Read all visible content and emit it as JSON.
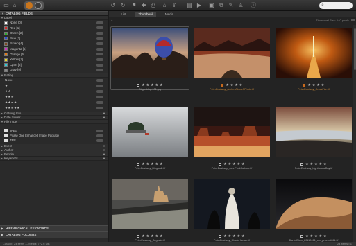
{
  "toolbar": {
    "icons": [
      "folder-icon",
      "home-icon",
      "rotate-left-icon",
      "rotate-right-icon",
      "flag-icon",
      "pick-icon",
      "print-icon",
      "shop-icon",
      "export-icon",
      "play-icon",
      "view-icon",
      "copy-icon",
      "paint-icon",
      "stamp-icon",
      "info-icon"
    ],
    "search_placeholder": ""
  },
  "sidebar": {
    "catalog_fields": "CATALOG FIELDS",
    "label_heading": "Label",
    "labels": [
      {
        "name": "None [0]",
        "color": "#ffffff"
      },
      {
        "name": "Red [1]",
        "color": "#d42b2b"
      },
      {
        "name": "Green [2]",
        "color": "#2fa82f"
      },
      {
        "name": "Blue [3]",
        "color": "#2a4fd6"
      },
      {
        "name": "Brown [4]",
        "color": "#7a4a24"
      },
      {
        "name": "Magenta [5]",
        "color": "#cc2fbe"
      },
      {
        "name": "Orange [6]",
        "color": "#e07a18"
      },
      {
        "name": "Yellow [7]",
        "color": "#e8dc28"
      },
      {
        "name": "Cyan [8]",
        "color": "#2ec8d6"
      },
      {
        "name": "Gray [9]",
        "color": "#888888"
      }
    ],
    "rating_heading": "Rating",
    "ratings": [
      "None",
      "★",
      "★★",
      "★★★",
      "★★★★",
      "★★★★★"
    ],
    "catalog_info": "Catalog Info",
    "date_finder": "Date Finder",
    "file_type_heading": "File Type",
    "file_types": [
      "JPEG",
      "Phase One Enhanced Image Package",
      "TIFF"
    ],
    "event": "Event",
    "author": "Author",
    "people": "People",
    "keywords": "Keywords",
    "hierarchical_keywords": "HIERARCHICAL KEYWORDS",
    "catalog_folders": "CATALOG FOLDERS"
  },
  "main": {
    "tabs": [
      "List",
      "Thumbnail",
      "Media"
    ],
    "active_tab": "Thumbnail",
    "thumbnail_size": "Thumbnail Size: 140 pixels"
  },
  "thumbnails": [
    {
      "file": "Stiglerblog-101.jpg",
      "stars": "★ ★ ★ ★ ★",
      "orange": false,
      "selected": true
    },
    {
      "file": "PeterEastway_ArchesAbove5Photo.tif",
      "stars": "★ ★ ★ ★",
      "orange": true,
      "selected": false
    },
    {
      "file": "PeterEastway_CrossFire.tif",
      "stars": "★ ★ ★ ★",
      "orange": true,
      "selected": false
    },
    {
      "file": "PeterEastway_DingoAZ.tif",
      "stars": "★ ★ ★ ★ ★",
      "orange": false,
      "selected": false
    },
    {
      "file": "PeterEastway_JohnFordOutlook.tif",
      "stars": "★ ★ ★ ★ ★",
      "orange": false,
      "selected": false
    },
    {
      "file": "PeterEastway_LighthouseBay.tif",
      "stars": "★ ★ ★ ★ ★",
      "orange": false,
      "selected": false
    },
    {
      "file": "PeterEastway_Segovia.tif",
      "stars": "★ ★ ★ ★ ★",
      "orange": false,
      "selected": false
    },
    {
      "file": "PeterEastway_ShadaHarran.tif",
      "stars": "★ ★ ★ ★ ★",
      "orange": false,
      "selected": false
    },
    {
      "file": "DanielBlom_20110421_ore_proein1661.tif",
      "stars": "★ ★ ★ ★ ★",
      "orange": false,
      "selected": false
    }
  ],
  "status": {
    "left": "Catalog: 24 items — Media: 772.6 MB",
    "right": "24 items • 1"
  }
}
